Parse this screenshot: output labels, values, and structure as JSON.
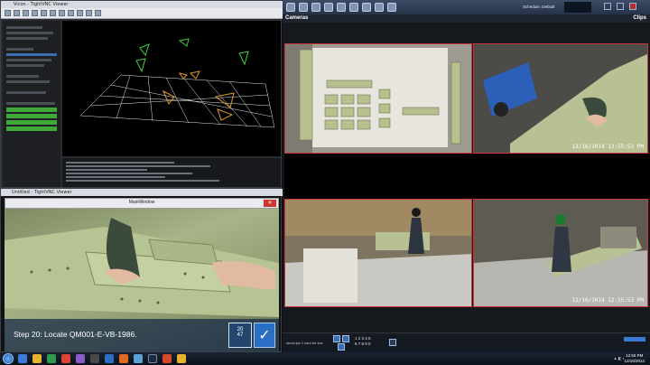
{
  "viewer": {
    "title": "Vicon - TightVNC Viewer"
  },
  "work_window": {
    "title": "Untitled - TightVNC Viewer",
    "inner_title": "MainWindow",
    "caption": "Step 20: Locate QM001-E-VB-1986.",
    "step_current": "20",
    "step_total": "47",
    "check_icon": "checkmark-icon"
  },
  "nvr": {
    "schedule": "Schedule: Default",
    "section_left": "Cameras",
    "section_right": "Clips",
    "cameras": [
      {
        "label": "",
        "timestamp": ""
      },
      {
        "label": "",
        "timestamp": "12/16/2014  12:55:53 PM"
      },
      {
        "label": "",
        "timestamp": ""
      },
      {
        "label": "",
        "timestamp": "12/16/2014  12:55:53 PM"
      }
    ],
    "bottom_left": "show fps // cam for kcs",
    "numpad_row1": "1 2 3 4 5",
    "numpad_row2": "6 7 8 9 0"
  },
  "taskbar": {
    "clock_time": "12:55 PM",
    "clock_date": "12/16/2014"
  },
  "colors": {
    "camera_border": "#c93538",
    "accent_blue": "#2b6fc4",
    "tracking_green": "#41a83a"
  }
}
